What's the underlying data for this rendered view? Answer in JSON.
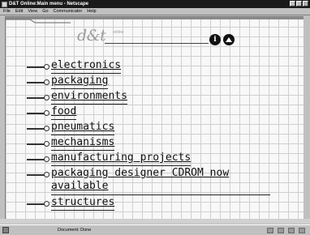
{
  "window": {
    "title": "D&T Online:Main menu - Netscape"
  },
  "menu_bar": [
    {
      "label": "File"
    },
    {
      "label": "Edit"
    },
    {
      "label": "View"
    },
    {
      "label": "Go"
    },
    {
      "label": "Communicator"
    },
    {
      "label": "Help"
    }
  ],
  "logo": {
    "text": "d&t",
    "superscript": "online"
  },
  "menu_items": [
    {
      "label": "electronics"
    },
    {
      "label": "packaging"
    },
    {
      "label": "environments"
    },
    {
      "label": "food"
    },
    {
      "label": "pneumatics"
    },
    {
      "label": "mechanisms"
    },
    {
      "label": "manufacturing projects"
    },
    {
      "label": "packaging designer CDROM now available"
    },
    {
      "label": "structures"
    }
  ],
  "status": {
    "text": "Document: Done"
  }
}
